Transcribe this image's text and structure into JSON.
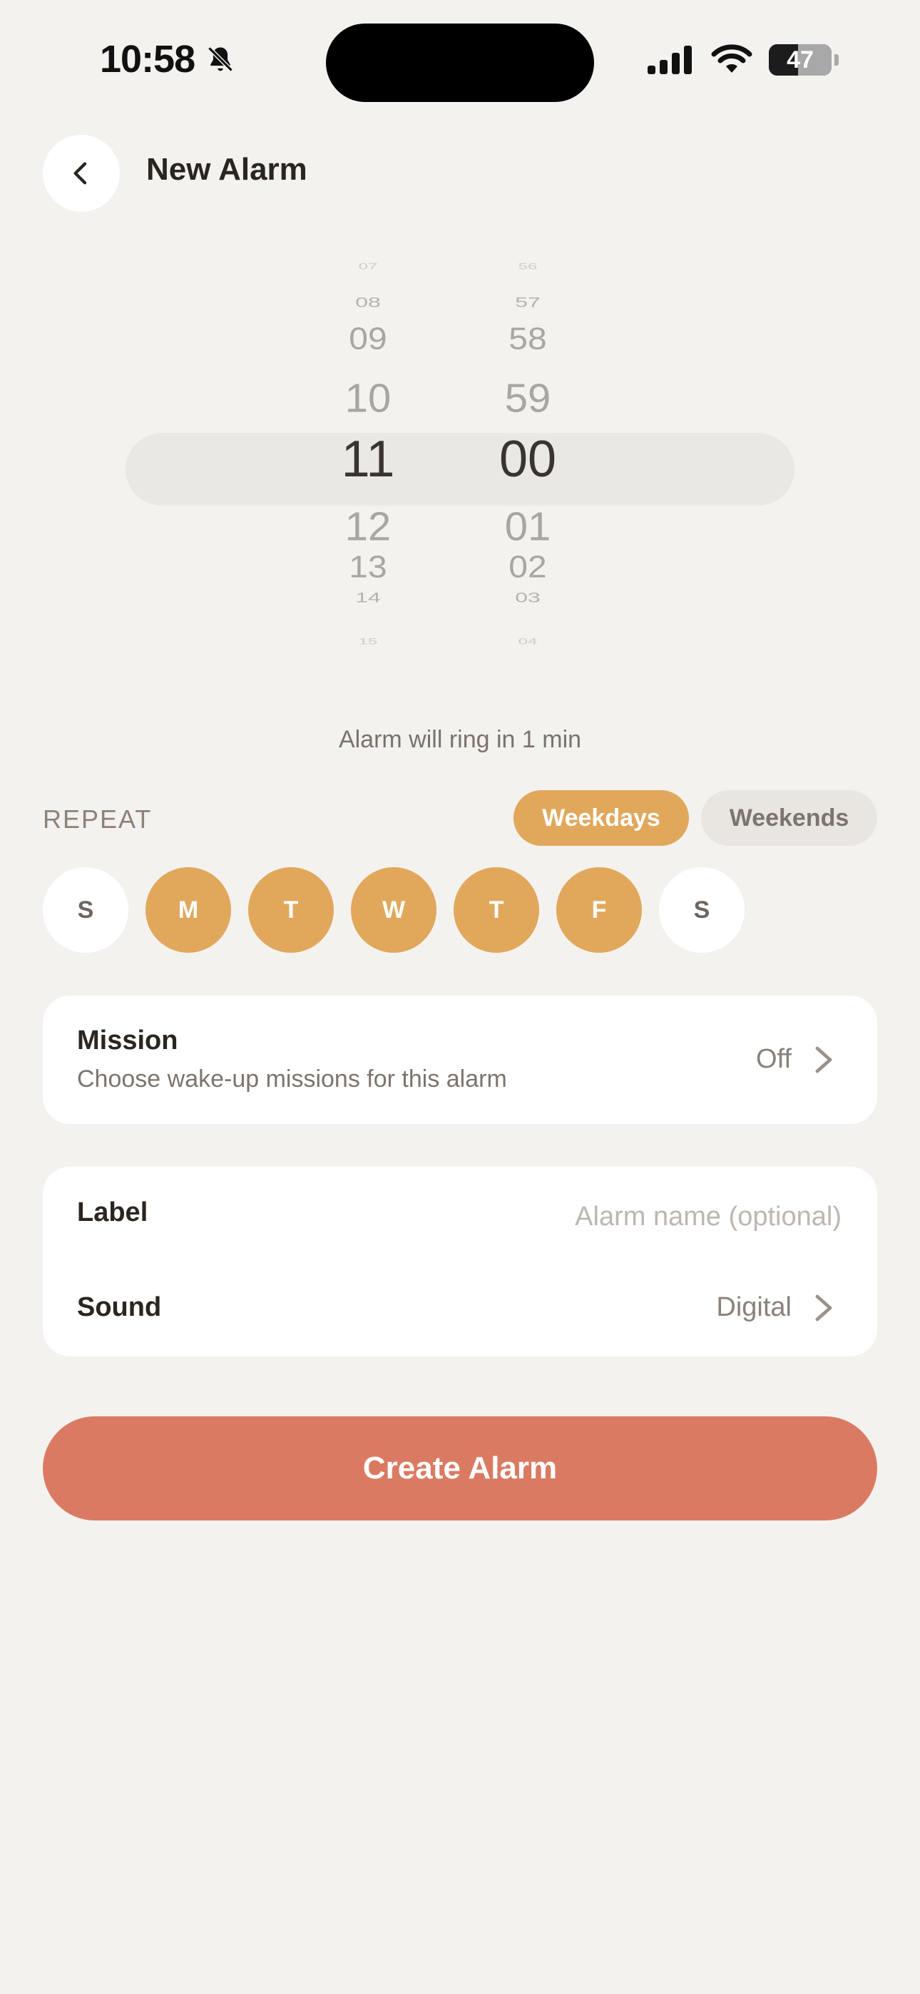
{
  "status_bar": {
    "time": "10:58",
    "silent_icon": "bell-slash-icon",
    "battery_percent": "47",
    "battery_level": 0.47
  },
  "header": {
    "title": "New Alarm",
    "back_icon": "chevron-left-icon"
  },
  "picker": {
    "hours": [
      "07",
      "08",
      "09",
      "10",
      "11",
      "12",
      "13",
      "14",
      "15"
    ],
    "minutes": [
      "56",
      "57",
      "58",
      "59",
      "00",
      "01",
      "02",
      "03",
      "04"
    ],
    "selected_hour": "11",
    "selected_minute": "00"
  },
  "ring_hint": "Alarm will ring in 1 min",
  "repeat": {
    "label": "REPEAT",
    "presets": [
      {
        "label": "Weekdays",
        "active": true
      },
      {
        "label": "Weekends",
        "active": false
      }
    ],
    "days": [
      {
        "label": "S",
        "selected": false
      },
      {
        "label": "M",
        "selected": true
      },
      {
        "label": "T",
        "selected": true
      },
      {
        "label": "W",
        "selected": true
      },
      {
        "label": "T",
        "selected": true
      },
      {
        "label": "F",
        "selected": true
      },
      {
        "label": "S",
        "selected": false
      }
    ]
  },
  "mission": {
    "title": "Mission",
    "subtitle": "Choose wake-up missions for this alarm",
    "value": "Off"
  },
  "details": {
    "label_title": "Label",
    "label_placeholder": "Alarm name (optional)",
    "label_value": "",
    "sound_title": "Sound",
    "sound_value": "Digital"
  },
  "create_button": "Create Alarm",
  "colors": {
    "accent": "#e1a85c",
    "primary_button": "#db7a62",
    "background": "#f4f2ee"
  }
}
